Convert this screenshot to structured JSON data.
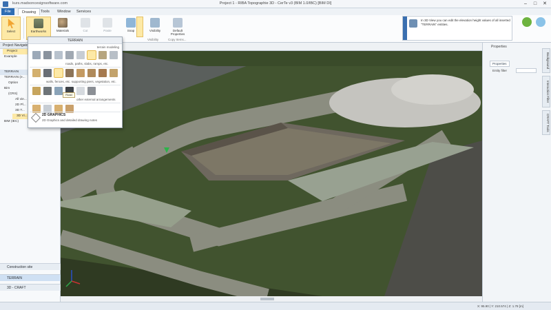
{
  "window": {
    "url": "kurs.madsoncesignsoftware.com",
    "title": "Project 1 - RIBA Topographie 3D - CerTe v3 (BIM 1.0/IBC) [BIM DI]",
    "min": "–",
    "max": "□",
    "close": "✕"
  },
  "tabs": [
    "File",
    "Drawing",
    "Tools",
    "Window",
    "Services"
  ],
  "ribbon": {
    "select": "Select",
    "earthworks": "Earthworks",
    "materials": "Materials",
    "cut": "Cut",
    "paste": "Paste",
    "snap": "Snap",
    "visibility": "Visibility",
    "default_properties": "Default Properties",
    "group_labels": [
      "Visibility",
      "Copy Items..."
    ],
    "info_text": "In 3D View you can edit the elevation height values of all inserted \"TERRAIN\" entities."
  },
  "dropdown": {
    "header": "TERRAIN",
    "section_terrain": "terrain modeling",
    "sub1": "roads, paths, slabs, ramps, etc.",
    "sub2": "walls, fences, etc. supporting piers, vegetation, etc.",
    "sub3": "other external arrangements",
    "tooltip": "Road",
    "graphics_title": "2D GRAPHICS",
    "graphics_desc": "2D Graphics and detailed drawing notes"
  },
  "left_panel": {
    "header": "Project Navigator",
    "items": [
      "Project",
      "Example",
      "TERRAIN",
      "TERRAIN (e...",
      "Option",
      "Bim",
      "(CRS)",
      "All vie...",
      "2D Pl...",
      "3D T...",
      "3D Vi...",
      "BIM (IEC)"
    ],
    "bottom": [
      "Construction site",
      "TERRAIN",
      "3D - CRAFT"
    ]
  },
  "right_panel": {
    "title": "Properties",
    "tab": "Properties",
    "label": "Entity filter",
    "side_tabs": [
      "Background",
      "Interaction Filter",
      "CRAFT Tools"
    ]
  },
  "status": {
    "coords": "X: 95.90 | Y: 210.574 | Z: 1.78 [m]"
  },
  "colors": {
    "accent": "#2e6db4",
    "grass": "#40512f",
    "path": "#8c8e7f",
    "pit": "#6d675d",
    "gravel": "#c3c2bd"
  }
}
